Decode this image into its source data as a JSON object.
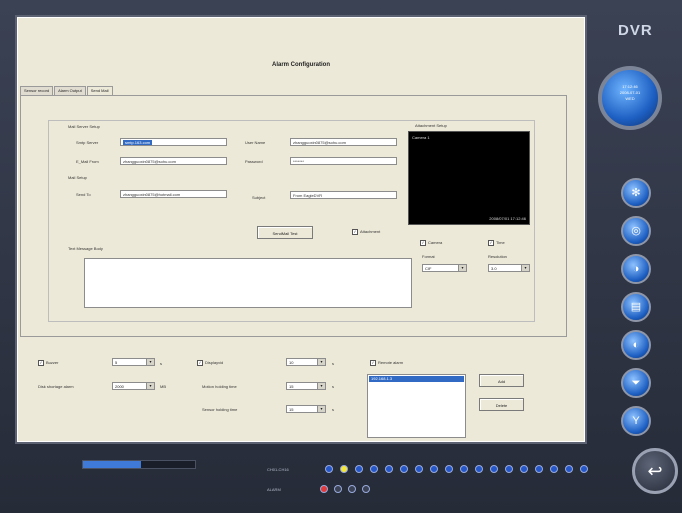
{
  "brand": "DVR",
  "window": {
    "title": "Alarm Configuration"
  },
  "tabs": [
    {
      "label": "Sensor record"
    },
    {
      "label": "Alarm Output"
    },
    {
      "label": "Send Mail"
    }
  ],
  "mail_server": {
    "group_label": "Mail Server Setup",
    "smtp_label": "Smtp Server",
    "smtp_value": "smtp.163.com",
    "user_label": "User Name",
    "user_value": "zhangguoxin0875@sohu.com",
    "email_from_label": "E_Mail From",
    "email_from_value": "zhangguoxin0875@sohu.com",
    "password_label": "Password",
    "password_value": "*******"
  },
  "mail_setup": {
    "group_label": "Mail Setup",
    "send_to_label": "Send To",
    "send_to_value": "zhangguoxin0875@hotmail.com",
    "subject_label": "Subject",
    "subject_value": "From EagleDVR"
  },
  "send_mail_test": "SendMail Test",
  "attachment_label": "Attachment",
  "text_message_label": "Text Message Body",
  "attachment_setup": {
    "label": "Attachment Setup",
    "preview_camera": "Camera 1",
    "preview_time": "2008/07/01 17:12:46",
    "camera_label": "Camera",
    "time_label": "Time",
    "format_label": "Format",
    "format_value": "CIF",
    "resolution_label": "Resolution",
    "resolution_value": "3.0"
  },
  "bottom_controls": {
    "buzzer_label": "Buzzer",
    "buzzer_value": "5",
    "buzzer_unit": "s",
    "disk_label": "Disk shortage alarm",
    "disk_value": "2000",
    "disk_unit": "MB",
    "displayvid_label": "Displayvid",
    "displayvid_value": "10",
    "displayvid_unit": "s",
    "motion_label": "Motion holding time",
    "motion_value": "15",
    "motion_unit": "s",
    "sensor_label": "Sensor holding time",
    "sensor_value": "15",
    "sensor_unit": "s",
    "remote_label": "Remote alarm",
    "remote_item": "192.168.1.3",
    "add_button": "Add",
    "delete_button": "Delete"
  },
  "clock": {
    "line1": "17:12:46",
    "line2": "2008-07-01",
    "line3": "WED"
  },
  "channels": {
    "row1_label": "CH01-CH16",
    "row2_label": "ALARM"
  },
  "colors": {
    "accent": "#316ac5",
    "panel": "#ece9d8",
    "frame": "#2b3140"
  }
}
